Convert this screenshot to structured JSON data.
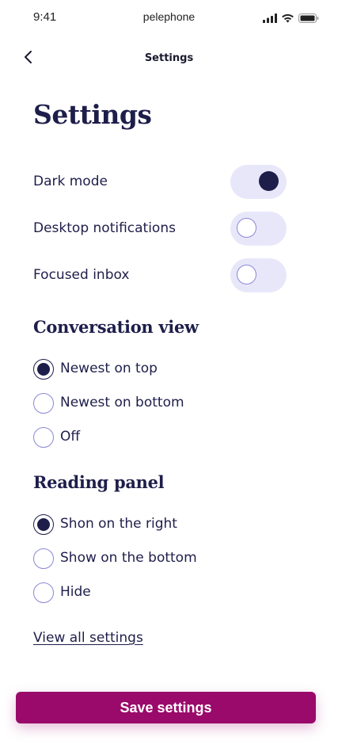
{
  "status_bar": {
    "time": "9:41",
    "carrier": "pelephone",
    "icons": [
      "signal-icon",
      "wifi-icon",
      "battery-icon"
    ]
  },
  "nav": {
    "back_icon": "chevron-left-icon",
    "title": "Settings"
  },
  "page": {
    "title": "Settings"
  },
  "toggles": [
    {
      "label": "Dark mode",
      "on": true
    },
    {
      "label": "Desktop notifications",
      "on": false
    },
    {
      "label": "Focused inbox",
      "on": false
    }
  ],
  "conversation_view": {
    "title": "Conversation view",
    "options": [
      {
        "label": "Newest on top",
        "checked": true
      },
      {
        "label": "Newest on bottom",
        "checked": false
      },
      {
        "label": "Off",
        "checked": false
      }
    ]
  },
  "reading_panel": {
    "title": "Reading panel",
    "options": [
      {
        "label": "Shon on the right",
        "checked": true
      },
      {
        "label": "Show on the bottom",
        "checked": false
      },
      {
        "label": "Hide",
        "checked": false
      }
    ]
  },
  "links": {
    "view_all": "View all settings"
  },
  "footer": {
    "save_label": "Save settings"
  },
  "colors": {
    "primary": "#1e1e4b",
    "toggle_track": "#e8e7fa",
    "radio_border": "#8b88d6",
    "save_button": "#9a0a6a"
  }
}
